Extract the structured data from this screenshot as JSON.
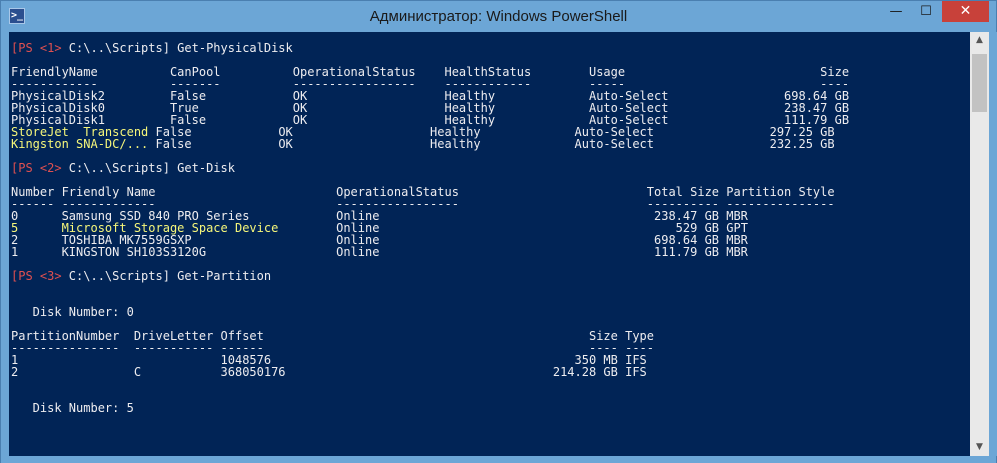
{
  "window": {
    "title": "Администратор: Windows PowerShell",
    "icon_glyph": ">_",
    "minimize_glyph": "—",
    "maximize_glyph": "☐",
    "close_glyph": "✕"
  },
  "scrollbar": {
    "up_glyph": "▲",
    "down_glyph": "▼"
  },
  "colors": {
    "console_bg": "#012456",
    "text": "#eeedf0",
    "prompt": "#e05050",
    "highlight": "#f6f77a",
    "titlebar": "#6ca6d6",
    "close_button": "#c8413a"
  },
  "console": {
    "lines": [
      {
        "prompt": "[PS <1> ",
        "text": "C:\\..\\Scripts] Get-PhysicalDisk"
      },
      {
        "text": ""
      },
      {
        "text": "FriendlyName          CanPool          OperationalStatus    HealthStatus        Usage                           Size"
      },
      {
        "text": "------------          -------          -----------------    ------------        -----                           ----"
      },
      {
        "text": "PhysicalDisk2         False            OK                   Healthy             Auto-Select                698.64 GB"
      },
      {
        "text": "PhysicalDisk0         True             OK                   Healthy             Auto-Select                238.47 GB"
      },
      {
        "text": "PhysicalDisk1         False            OK                   Healthy             Auto-Select                111.79 GB"
      },
      {
        "highlight": "StoreJet  Transcend ",
        "text": "False            OK                   Healthy             Auto-Select                297.25 GB"
      },
      {
        "highlight": "Kingston SNA-DC/... ",
        "text": "False            OK                   Healthy             Auto-Select                232.25 GB"
      },
      {
        "text": ""
      },
      {
        "prompt": "[PS <2> ",
        "text": "C:\\..\\Scripts] Get-Disk"
      },
      {
        "text": ""
      },
      {
        "text": "Number Friendly Name                         OperationalStatus                          Total Size Partition Style"
      },
      {
        "text": "------ -------------                         -----------------                          ---------- ---------------"
      },
      {
        "text": "0      Samsung SSD 840 PRO Series            Online                                      238.47 GB MBR"
      },
      {
        "highlight": "5      Microsoft Storage Space Device        ",
        "text": "Online                                         529 GB GPT"
      },
      {
        "text": "2      TOSHIBA MK7559GSXP                    Online                                      698.64 GB MBR"
      },
      {
        "text": "1      KINGSTON SH103S3120G                  Online                                      111.79 GB MBR"
      },
      {
        "text": ""
      },
      {
        "prompt": "[PS <3> ",
        "text": "C:\\..\\Scripts] Get-Partition"
      },
      {
        "text": ""
      },
      {
        "text": ""
      },
      {
        "text": "   Disk Number: 0"
      },
      {
        "text": ""
      },
      {
        "text": "PartitionNumber  DriveLetter Offset                                             Size Type"
      },
      {
        "text": "---------------  ----------- ------                                             ---- ----"
      },
      {
        "text": "1                            1048576                                          350 MB IFS"
      },
      {
        "text": "2                C           368050176                                     214.28 GB IFS"
      },
      {
        "text": ""
      },
      {
        "text": ""
      },
      {
        "text": "   Disk Number: 5"
      }
    ]
  }
}
